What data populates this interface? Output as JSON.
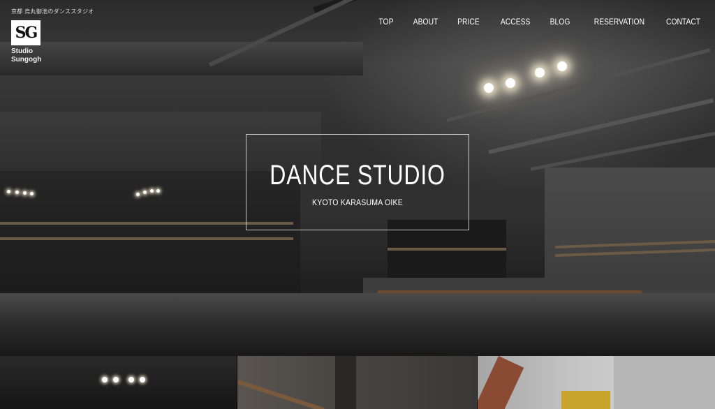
{
  "header": {
    "tagline": "京都 烏丸御池のダンススタジオ",
    "logo_mark": "SG",
    "logo_line1": "Studio",
    "logo_line2": "Sungogh"
  },
  "nav": {
    "items": [
      "TOP",
      "ABOUT",
      "PRICE",
      "ACCESS",
      "BLOG",
      "RESERVATION",
      "CONTACT"
    ]
  },
  "hero": {
    "title": "DANCE STUDIO",
    "subtitle": "KYOTO KARASUMA OIKE"
  },
  "colors": {
    "text": "#ffffff",
    "background": "#0d0d0d",
    "logo_bg": "#ffffff"
  }
}
